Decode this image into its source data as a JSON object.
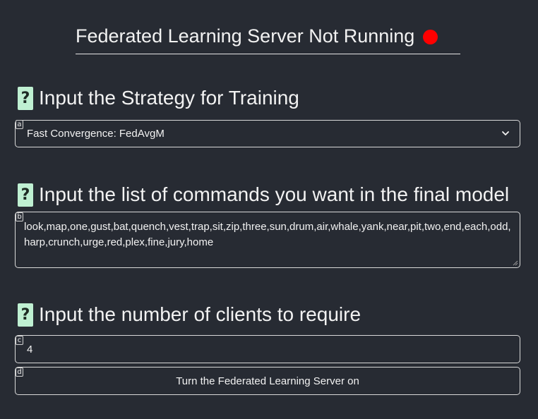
{
  "status": {
    "text": "Federated Learning Server Not Running",
    "indicator_color": "#ff0000"
  },
  "strategy": {
    "help_icon": "?",
    "heading": "Input the Strategy for Training",
    "hint": "a",
    "selected": "Fast Convergence: FedAvgM"
  },
  "commands": {
    "help_icon": "?",
    "heading": "Input the list of commands you want in the final model",
    "hint": "b",
    "value": "look,map,one,gust,bat,quench,vest,trap,sit,zip,three,sun,drum,air,whale,yank,near,pit,two,end,each,odd,harp,crunch,urge,red,plex,fine,jury,home"
  },
  "clients": {
    "help_icon": "?",
    "heading": "Input the number of clients to require",
    "hint": "c",
    "value": "4"
  },
  "action": {
    "hint": "d",
    "label": "Turn the Federated Learning Server on"
  },
  "colors": {
    "background": "#272b33",
    "help_icon_bg": "#bff0d2",
    "status_off": "#ff0000"
  }
}
